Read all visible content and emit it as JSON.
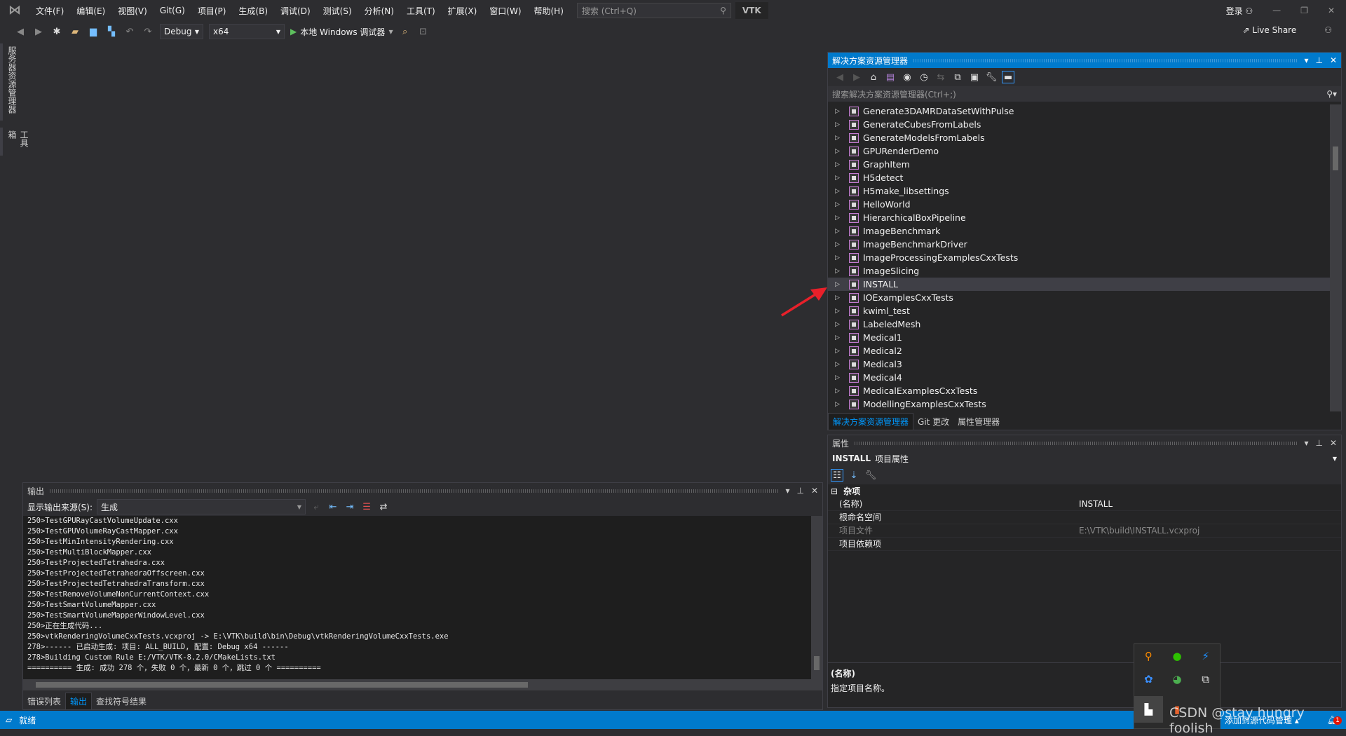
{
  "menubar": {
    "items": [
      "文件(F)",
      "编辑(E)",
      "视图(V)",
      "Git(G)",
      "项目(P)",
      "生成(B)",
      "调试(D)",
      "测试(S)",
      "分析(N)",
      "工具(T)",
      "扩展(X)",
      "窗口(W)",
      "帮助(H)"
    ],
    "search_placeholder": "搜索 (Ctrl+Q)",
    "solution_name": "VTK",
    "login": "登录",
    "live_share": "Live Share"
  },
  "toolbar": {
    "config": "Debug",
    "platform": "x64",
    "run_label": "本地 Windows 调试器"
  },
  "left_tabs": [
    "服务器资源管理器",
    "工具箱"
  ],
  "solution_explorer": {
    "title": "解决方案资源管理器",
    "search_placeholder": "搜索解决方案资源管理器(Ctrl+;)",
    "items": [
      "Generate3DAMRDataSetWithPulse",
      "GenerateCubesFromLabels",
      "GenerateModelsFromLabels",
      "GPURenderDemo",
      "GraphItem",
      "H5detect",
      "H5make_libsettings",
      "HelloWorld",
      "HierarchicalBoxPipeline",
      "ImageBenchmark",
      "ImageBenchmarkDriver",
      "ImageProcessingExamplesCxxTests",
      "ImageSlicing",
      "INSTALL",
      "IOExamplesCxxTests",
      "kwiml_test",
      "LabeledMesh",
      "Medical1",
      "Medical2",
      "Medical3",
      "Medical4",
      "MedicalExamplesCxxTests",
      "ModellingExamplesCxxTests"
    ],
    "selected": "INSTALL",
    "tabs": [
      "解决方案资源管理器",
      "Git 更改",
      "属性管理器"
    ]
  },
  "properties": {
    "title": "属性",
    "object_name": "INSTALL",
    "object_type": "项目属性",
    "category": "杂项",
    "rows": [
      {
        "key": "(名称)",
        "value": "INSTALL"
      },
      {
        "key": "根命名空间",
        "value": ""
      },
      {
        "key": "项目文件",
        "value": "E:\\VTK\\build\\INSTALL.vcxproj"
      },
      {
        "key": "项目依赖项",
        "value": ""
      }
    ],
    "desc_title": "(名称)",
    "desc_text": "指定项目名称。"
  },
  "output": {
    "title": "输出",
    "source_label": "显示输出来源(S):",
    "source_value": "生成",
    "lines": [
      "250>TestGPURayCastVolumeUpdate.cxx",
      "250>TestGPUVolumeRayCastMapper.cxx",
      "250>TestMinIntensityRendering.cxx",
      "250>TestMultiBlockMapper.cxx",
      "250>TestProjectedTetrahedra.cxx",
      "250>TestProjectedTetrahedraOffscreen.cxx",
      "250>TestProjectedTetrahedraTransform.cxx",
      "250>TestRemoveVolumeNonCurrentContext.cxx",
      "250>TestSmartVolumeMapper.cxx",
      "250>TestSmartVolumeMapperWindowLevel.cxx",
      "250>正在生成代码...",
      "250>vtkRenderingVolumeCxxTests.vcxproj -> E:\\VTK\\build\\bin\\Debug\\vtkRenderingVolumeCxxTests.exe",
      "278>------ 已启动生成: 项目: ALL_BUILD, 配置: Debug x64 ------",
      "278>Building Custom Rule E:/VTK/VTK-8.2.0/CMakeLists.txt",
      "========== 生成: 成功 278 个，失败 0 个，最新 0 个，跳过 0 个 =========="
    ],
    "tabs": [
      "错误列表",
      "输出",
      "查找符号结果"
    ]
  },
  "status": {
    "text": "就绪",
    "right_text": "添加到源代码管理",
    "notification_count": "1"
  },
  "watermark": "CSDN @stay hungry foolish",
  "colors": {
    "accent": "#007acc",
    "arrow": "#e8202a"
  }
}
